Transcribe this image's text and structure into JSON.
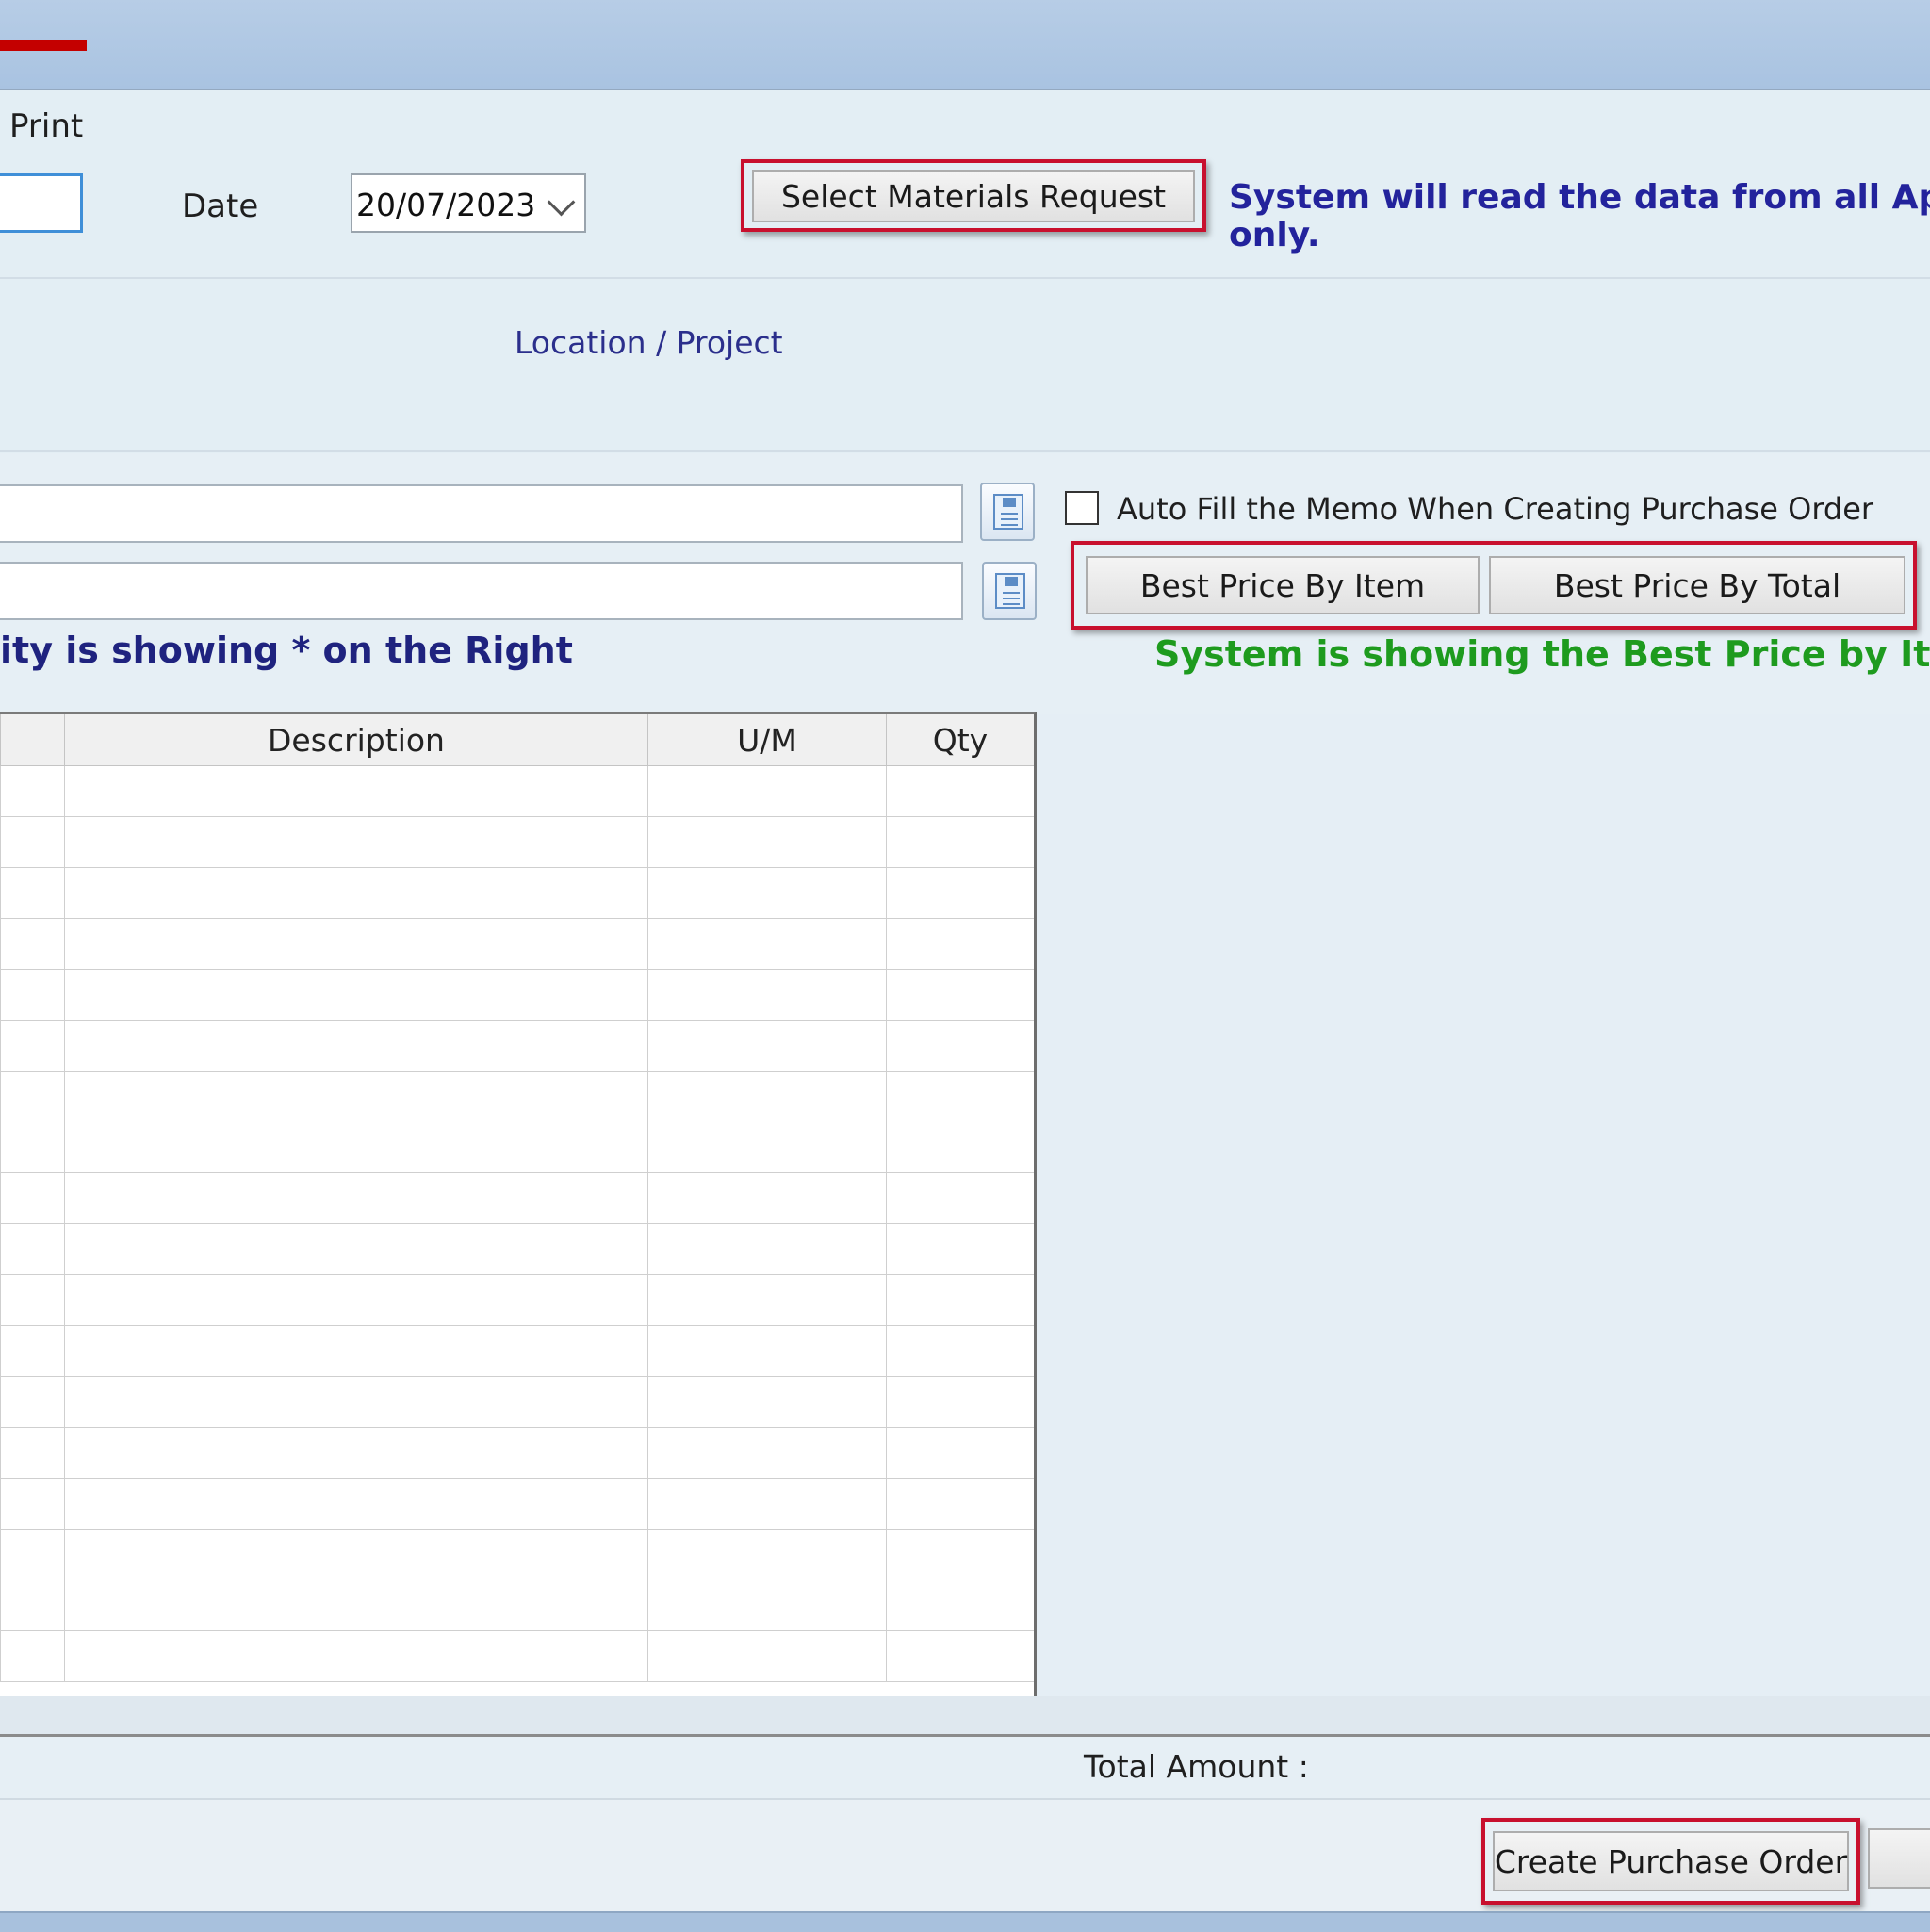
{
  "toolbar": {
    "print_label": "Print"
  },
  "header": {
    "date_label": "Date",
    "date_value": "20/07/2023",
    "select_mr_label": "Select Materials Request",
    "info_line1": "System will read the data from all Appro",
    "info_line2": "only.",
    "location_label": "Location / Project"
  },
  "memo": {
    "autofill_label": "Auto Fill the Memo When Creating Purchase Order",
    "best_item_label": "Best Price By Item",
    "best_total_label": "Best Price By Total",
    "priority_note": "ity is showing * on the Right",
    "best_price_status": "System is showing the Best Price by Item"
  },
  "grid": {
    "columns": [
      "Description",
      "U/M",
      "Qty"
    ],
    "row_count": 18
  },
  "footer": {
    "total_label": "Total Amount :",
    "create_po_label": "Create Purchase Order"
  }
}
